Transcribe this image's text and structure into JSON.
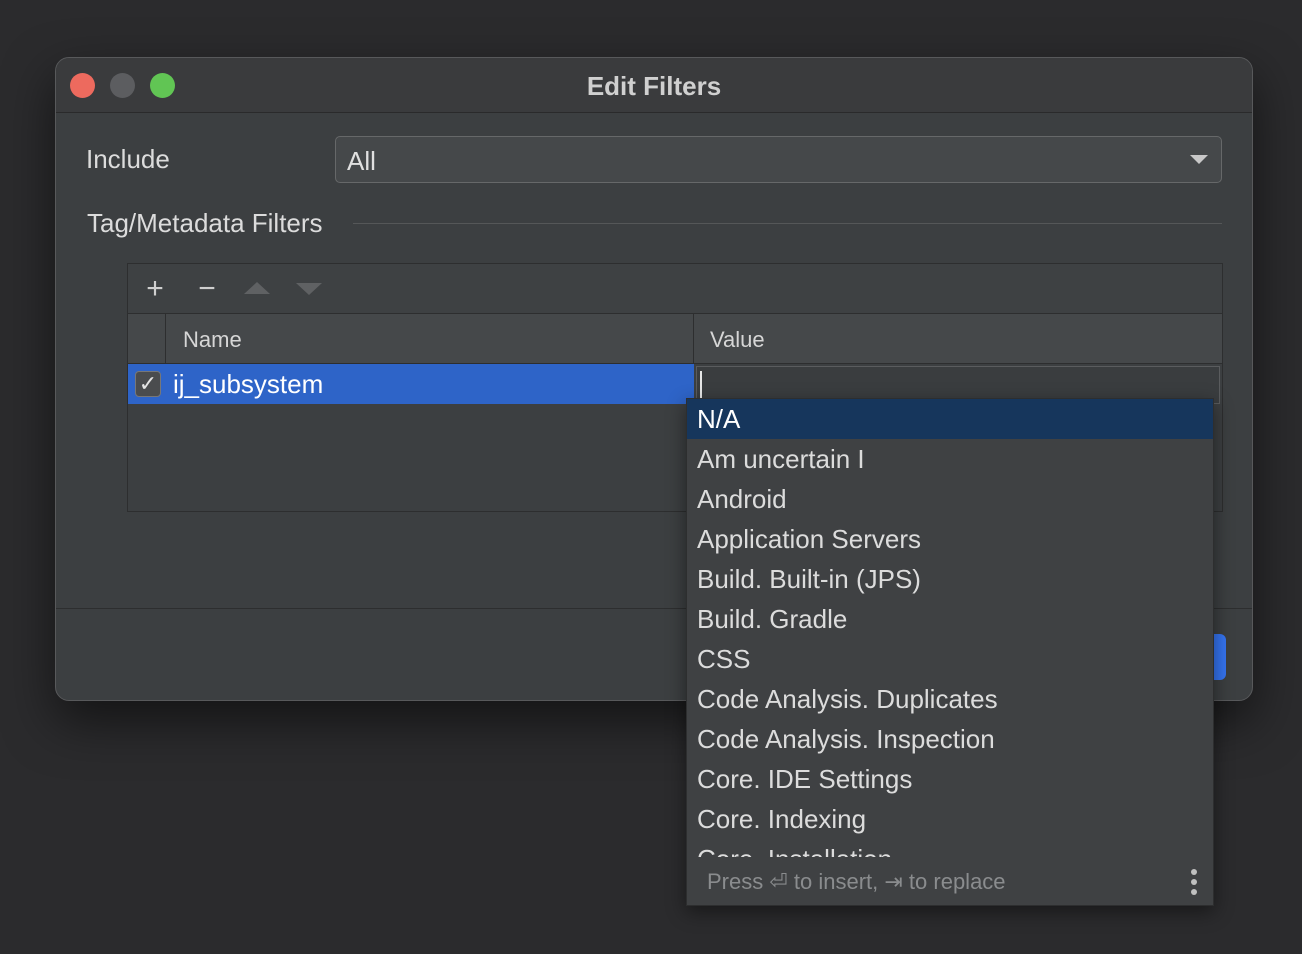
{
  "window": {
    "title": "Edit Filters"
  },
  "include": {
    "label": "Include",
    "value": "All"
  },
  "filters_group": {
    "label": "Tag/Metadata Filters"
  },
  "toolbar": {
    "add_glyph": "+",
    "remove_glyph": "−"
  },
  "table": {
    "columns": [
      "Name",
      "Value"
    ],
    "rows": [
      {
        "checked": true,
        "check_glyph": "✓",
        "name": "ij_subsystem",
        "value": ""
      }
    ]
  },
  "completion_popup": {
    "items": [
      "N/A",
      "Am uncertain I",
      "Android",
      "Application Servers",
      "Build. Built-in (JPS)",
      "Build. Gradle",
      "CSS",
      "Code Analysis. Duplicates",
      "Code Analysis. Inspection",
      "Core. IDE Settings",
      "Core. Indexing",
      "Core. Installation"
    ],
    "selected_index": 0,
    "hint": "Press ⏎ to insert, ⇥ to replace"
  },
  "colors": {
    "accent": "#2e64c8",
    "popup_selection": "#16365c",
    "primary_button": "#3574f0"
  }
}
